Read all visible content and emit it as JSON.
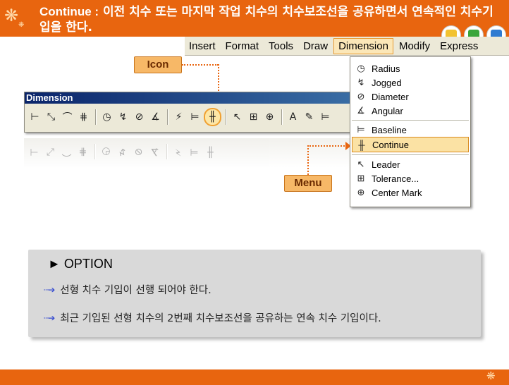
{
  "header": {
    "keyword": "Continue :",
    "description": " 이전 치수 또는 마지막 작업 치수의 치수보조선을 공유하면서 연속적인 치수기입을 한다.",
    "brand_colors": {
      "orange": "#e8650f",
      "callout": "#f7b867"
    }
  },
  "menubar": {
    "items": [
      "Insert",
      "Format",
      "Tools",
      "Draw",
      "Dimension",
      "Modify",
      "Express"
    ],
    "active": "Dimension"
  },
  "callouts": {
    "icon_label": "Icon",
    "menu_label": "Menu"
  },
  "toolbar": {
    "title": "Dimension",
    "icons": [
      "linear-dim-icon",
      "aligned-dim-icon",
      "arc-length-icon",
      "ordinate-icon",
      "radius-icon",
      "jogged-icon",
      "diameter-icon",
      "angular-icon",
      "quick-dim-icon",
      "baseline-icon",
      "continue-icon",
      "qleader-icon",
      "tolerance-icon",
      "center-mark-icon",
      "dimedit-icon",
      "dimtedit-icon",
      "dim-update-icon"
    ]
  },
  "dropdown": {
    "groups": [
      [
        {
          "label": "Radius",
          "icon": "radius-icon"
        },
        {
          "label": "Jogged",
          "icon": "jogged-icon"
        },
        {
          "label": "Diameter",
          "icon": "diameter-icon"
        },
        {
          "label": "Angular",
          "icon": "angular-icon"
        }
      ],
      [
        {
          "label": "Baseline",
          "icon": "baseline-icon"
        },
        {
          "label": "Continue",
          "icon": "continue-icon",
          "selected": true
        }
      ],
      [
        {
          "label": "Leader",
          "icon": "leader-icon"
        },
        {
          "label": "Tolerance...",
          "icon": "tolerance-icon"
        },
        {
          "label": "Center Mark",
          "icon": "center-mark-icon"
        }
      ]
    ]
  },
  "option": {
    "title": "► OPTION",
    "line1": "선형 치수 기입이 선행 되어야 한다.",
    "line2": "최근 기입된 선형 치수의 2번째 치수보조선을 공유하는 연속 치수 기입이다."
  }
}
